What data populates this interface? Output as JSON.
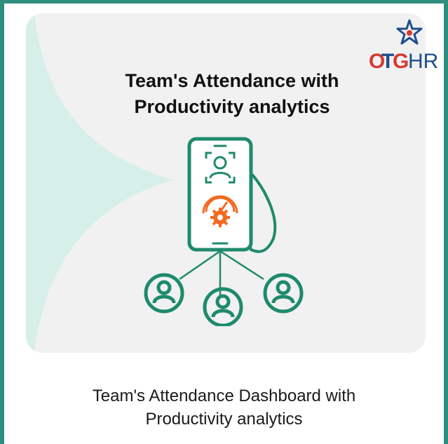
{
  "card": {
    "headline_line1": "Team's Attendance with",
    "headline_line2": "Productivity analytics"
  },
  "logo": {
    "text_o": "O",
    "text_t": "T",
    "text_g": "G",
    "text_hr": "HR"
  },
  "caption": {
    "line1": "Team's Attendance Dashboard with",
    "line2": "Productivity analytics"
  },
  "colors": {
    "frame": "#2f8f7f",
    "brand_green": "#1e8a6c",
    "accent_orange": "#f26b21",
    "swoosh": "#d6efe8",
    "logo_blue": "#1f4e8c",
    "logo_red": "#d63a2f"
  },
  "icons": [
    "user-scan-icon",
    "speedometer-gear-icon",
    "user-circle-icon",
    "star-logo-icon"
  ]
}
